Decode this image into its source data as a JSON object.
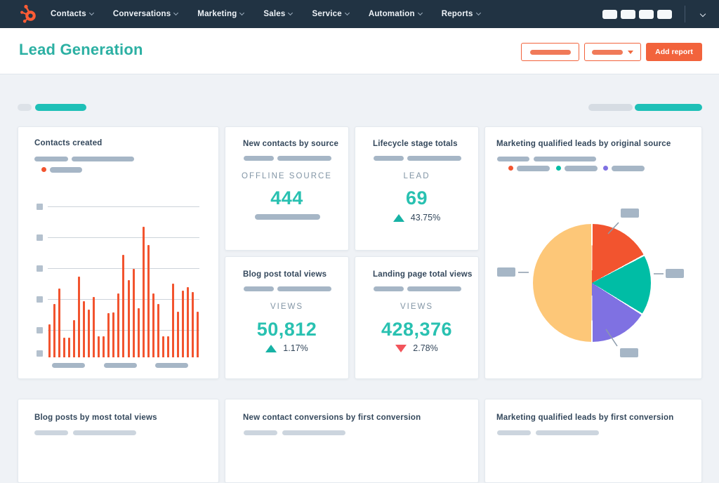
{
  "nav": {
    "items": [
      "Contacts",
      "Conversations",
      "Marketing",
      "Sales",
      "Service",
      "Automation",
      "Reports"
    ]
  },
  "header": {
    "title": "Lead Generation",
    "add_report_label": "Add report"
  },
  "cards": {
    "contacts_created": {
      "title": "Contacts created"
    },
    "new_contacts_by_source": {
      "title": "New contacts by source",
      "metric_label": "OFFLINE SOURCE",
      "value": "444"
    },
    "lifecycle_stage_totals": {
      "title": "Lifecycle stage totals",
      "metric_label": "LEAD",
      "value": "69",
      "delta": "43.75%",
      "delta_direction": "up"
    },
    "mql_by_original_source": {
      "title": "Marketing qualified leads by original source"
    },
    "blog_post_total_views": {
      "title": "Blog post total views",
      "metric_label": "VIEWS",
      "value": "50,812",
      "delta": "1.17%",
      "delta_direction": "up"
    },
    "landing_page_total_views": {
      "title": "Landing page total views",
      "metric_label": "VIEWS",
      "value": "428,376",
      "delta": "2.78%",
      "delta_direction": "down"
    },
    "blog_posts_by_most_total_views": {
      "title": "Blog posts by most total views"
    },
    "new_contact_conversions_by_first_conversion": {
      "title": "New contact conversions by first conversion"
    },
    "mql_by_first_conversion": {
      "title": "Marketing qualified leads by first conversion"
    }
  },
  "colors": {
    "nav_bg": "#213343",
    "accent_teal": "#1ec0b7",
    "accent_orange": "#f2633c",
    "chart_bar_orange": "#f2542f",
    "delta_up": "#17b2a5",
    "delta_down": "#f2545b",
    "placeholder_gray": "#a6b6c6"
  },
  "chart_data": [
    {
      "type": "bar",
      "title": "Contacts created",
      "bar_color": "#f2542f",
      "ylabels_hidden": true,
      "xlabels_hidden": true,
      "values": [
        47,
        76,
        98,
        28,
        28,
        53,
        115,
        80,
        68,
        86,
        30,
        30,
        63,
        64,
        91,
        146,
        110,
        126,
        70,
        186,
        160,
        91,
        76,
        30,
        30,
        105,
        65,
        95,
        100,
        93,
        65
      ]
    },
    {
      "type": "pie",
      "title": "Marketing qualified leads by original source",
      "slices": [
        {
          "name": "slice-1",
          "color": "#f2542f",
          "degrees": 62
        },
        {
          "name": "slice-2",
          "color": "#00bda5",
          "degrees": 60
        },
        {
          "name": "slice-3",
          "color": "#7f71e2",
          "degrees": 58
        },
        {
          "name": "slice-4",
          "color": "#fdc778",
          "degrees": 180
        }
      ],
      "legend_colors": [
        "#f2542f",
        "#00bda5",
        "#7f71e2"
      ]
    }
  ]
}
